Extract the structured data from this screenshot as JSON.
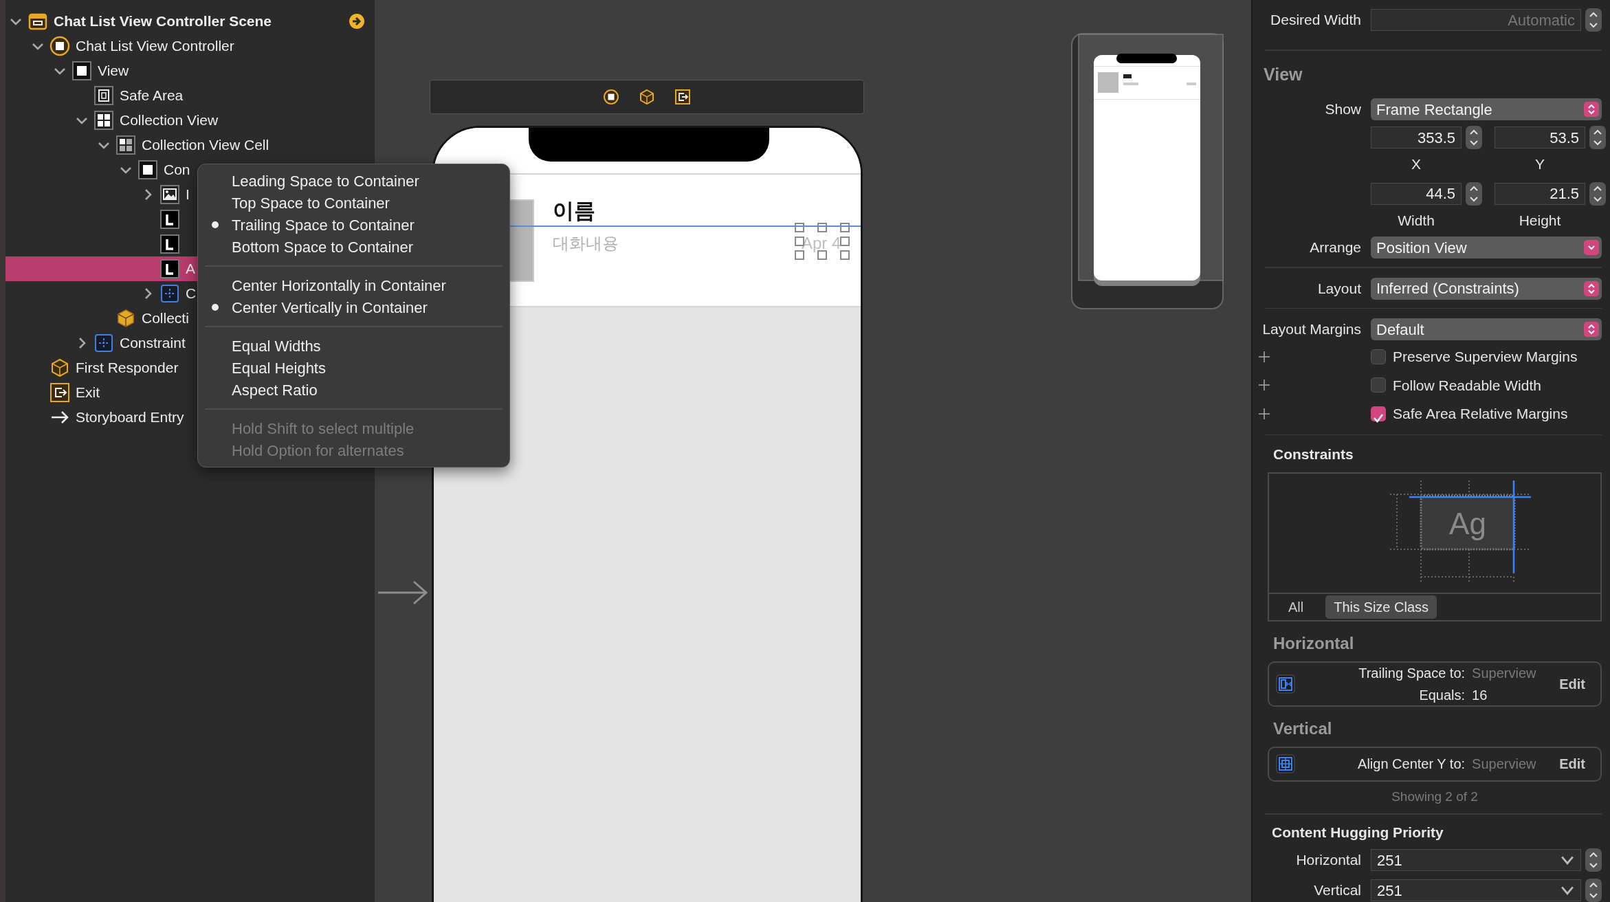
{
  "outline": {
    "items": [
      {
        "label": "Chat List View Controller Scene",
        "kind": "scene",
        "expanded": true,
        "selected": false,
        "children": [
          {
            "label": "Chat List View Controller",
            "kind": "controller",
            "expanded": true,
            "selected": false,
            "children": [
              {
                "label": "View",
                "kind": "view",
                "expanded": true,
                "selected": false,
                "children": [
                  {
                    "label": "Safe Area",
                    "kind": "safearea",
                    "selected": false
                  },
                  {
                    "label": "Collection View",
                    "kind": "collection",
                    "expanded": true,
                    "selected": false,
                    "children": [
                      {
                        "label": "Collection View Cell",
                        "kind": "cell",
                        "expanded": true,
                        "selected": false,
                        "children": [
                          {
                            "label": "Con",
                            "kind": "view",
                            "expanded": true,
                            "selected": false,
                            "children": [
                              {
                                "label": "I",
                                "kind": "image",
                                "expanded": false,
                                "selected": false
                              },
                              {
                                "kind": "label",
                                "selected": false
                              },
                              {
                                "kind": "label",
                                "selected": false
                              },
                              {
                                "label": "A",
                                "kind": "label",
                                "selected": true
                              },
                              {
                                "label": "C",
                                "kind": "constraints",
                                "expanded": false,
                                "selected": false
                              }
                            ]
                          }
                        ]
                      },
                      {
                        "label": "Collecti",
                        "kind": "layout",
                        "selected": false
                      }
                    ]
                  },
                  {
                    "label": "Constraint",
                    "kind": "constraints",
                    "expanded": false,
                    "selected": false
                  }
                ]
              }
            ]
          },
          {
            "label": "First Responder",
            "kind": "responder",
            "selected": false
          },
          {
            "label": "Exit",
            "kind": "exit",
            "selected": false
          },
          {
            "label": "Storyboard Entry",
            "kind": "entry",
            "selected": false
          }
        ]
      }
    ]
  },
  "menu": {
    "groups": [
      {
        "items": [
          {
            "label": "Leading Space to Container",
            "checked": false,
            "disabled": false
          },
          {
            "label": "Top Space to Container",
            "checked": false,
            "disabled": false
          },
          {
            "label": "Trailing Space to Container",
            "checked": true,
            "disabled": false
          },
          {
            "label": "Bottom Space to Container",
            "checked": false,
            "disabled": false
          }
        ]
      },
      {
        "items": [
          {
            "label": "Center Horizontally in Container",
            "checked": false,
            "disabled": false
          },
          {
            "label": "Center Vertically in Container",
            "checked": true,
            "disabled": false
          }
        ]
      },
      {
        "items": [
          {
            "label": "Equal Widths",
            "checked": false,
            "disabled": false
          },
          {
            "label": "Equal Heights",
            "checked": false,
            "disabled": false
          },
          {
            "label": "Aspect Ratio",
            "checked": false,
            "disabled": false
          }
        ]
      },
      {
        "items": [
          {
            "label": "Hold Shift to select multiple",
            "checked": false,
            "disabled": true
          },
          {
            "label": "Hold Option for alternates",
            "checked": false,
            "disabled": true
          }
        ]
      }
    ]
  },
  "canvas": {
    "cell": {
      "name": "이름",
      "message": "대화내용",
      "date": "Apr 4"
    }
  },
  "inspector": {
    "desired_width": {
      "label": "Desired Width",
      "placeholder": "Automatic"
    },
    "view": {
      "title": "View",
      "show": {
        "label": "Show",
        "value": "Frame Rectangle",
        "kind": "updown"
      },
      "frame": [
        {
          "value": "353.5",
          "caption": "X"
        },
        {
          "value": "53.5",
          "caption": "Y"
        },
        {
          "value": "44.5",
          "caption": "Width"
        },
        {
          "value": "21.5",
          "caption": "Height"
        }
      ],
      "arrange": {
        "label": "Arrange",
        "value": "Position View",
        "kind": "pulldown"
      },
      "layout": {
        "label": "Layout",
        "value": "Inferred (Constraints)",
        "kind": "updown"
      },
      "layout_margins": {
        "label": "Layout Margins",
        "value": "Default",
        "kind": "updown"
      },
      "options": [
        {
          "label": "Preserve Superview Margins",
          "checked": false
        },
        {
          "label": "Follow Readable Width",
          "checked": false
        },
        {
          "label": "Safe Area Relative Margins",
          "checked": true
        }
      ]
    },
    "constraints": {
      "title": "Constraints",
      "preview_text": "Ag",
      "filters": [
        {
          "label": "All",
          "selected": false
        },
        {
          "label": "This Size Class",
          "selected": true
        }
      ],
      "groups": [
        {
          "title": "Horizontal",
          "items": [
            {
              "kind": "trailing",
              "lines": [
                {
                  "label": "Trailing Space to:",
                  "value": "Superview",
                  "muted": true
                },
                {
                  "label": "Equals:",
                  "value": "16",
                  "muted": false
                }
              ],
              "action": "Edit"
            }
          ]
        },
        {
          "title": "Vertical",
          "items": [
            {
              "kind": "centery",
              "lines": [
                {
                  "label": "Align Center Y to:",
                  "value": "Superview",
                  "muted": true
                }
              ],
              "action": "Edit"
            }
          ]
        }
      ],
      "footer": "Showing 2 of 2"
    },
    "hugging": {
      "title": "Content Hugging Priority",
      "rows": [
        {
          "label": "Horizontal",
          "value": "251"
        },
        {
          "label": "Vertical",
          "value": "251"
        }
      ]
    }
  }
}
